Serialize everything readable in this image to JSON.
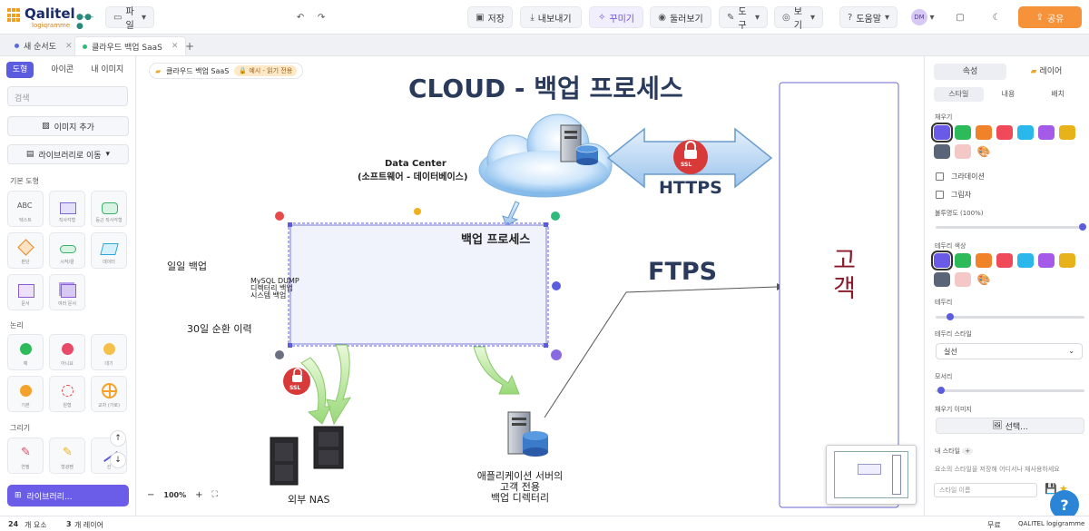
{
  "app": {
    "logo_name": "Qalitel",
    "logo_tagline": "logiqramme"
  },
  "toolbar": {
    "file_label": "파일",
    "undo_icon": "undo-icon",
    "redo_icon": "redo-icon",
    "save_label": "저장",
    "export_label": "내보내기",
    "beautify_label": "꾸미기",
    "tour_label": "둘러보기",
    "tools_label": "도구",
    "view_label": "보기",
    "help_label": "도움말",
    "avatar_initials": "DM",
    "share_label": "공유"
  },
  "tabs": [
    {
      "label": "새 순서도"
    },
    {
      "label": "클라우드 백업 SaaS"
    }
  ],
  "left_panel": {
    "tabs": [
      "도형",
      "아이콘",
      "내 이미지"
    ],
    "search_placeholder": "검색",
    "add_image_label": "이미지 추가",
    "library_label": "라이브러리로 이동",
    "section_basic": "기본 도형",
    "section_logic": "논리",
    "section_draw": "그리기",
    "basic_shapes": [
      "텍스트",
      "직사각형",
      "둥근 직사각형",
      "판단",
      "시작/끝",
      "데이터",
      "문서",
      "여러 문서"
    ],
    "logic_shapes": [
      "예",
      "아니요",
      "대기",
      "기본",
      "원형",
      "교차 (가로)"
    ],
    "draw_tools": [
      "연필",
      "형광펜",
      "선"
    ],
    "library_bottom_label": "라이브러리..."
  },
  "statusbar": {
    "elements_count": "24",
    "elements_label": "개 요소",
    "layers_count": "3",
    "layers_label": "개 레이어",
    "plan": "무료",
    "brand": "QALITEL logigramme"
  },
  "canvas": {
    "breadcrumb": "클라우드 백업 SaaS",
    "breadcrumb_badge": "예시 - 읽기 전용",
    "title": "CLOUD - 백업 프로세스",
    "datacenter_line1": "Data Center",
    "datacenter_line2": "(소프트웨어 - 데이터베이스)",
    "https_label": "HTTPS",
    "ftps_label": "FTPS",
    "process_label": "백업 프로세스",
    "mysql_line1": "MySQL DUMP",
    "mysql_line2": "디렉터리 백업",
    "mysql_line3": "시스템 백업",
    "daily_backup": "일일 백업",
    "rotation": "30일 순환 이력",
    "customer_label": "고객",
    "nas_label": "외부 NAS",
    "appserver_line1": "애플리케이션 서버의",
    "appserver_line2": "고객 전용",
    "appserver_line3": "백업 디렉터리",
    "ssl_label": "SSL",
    "zoom_level": "100%"
  },
  "right_panel": {
    "tab_properties": "속성",
    "tab_layers": "레이어",
    "sub_tabs": [
      "스타일",
      "내용",
      "배치"
    ],
    "fill_label": "채우기",
    "gradient_label": "그라데이션",
    "shadow_label": "그림자",
    "opacity_label": "불투명도 (100%)",
    "border_color_label": "테두리 색상",
    "border_label": "테두리",
    "border_style_label": "테두리 스타일",
    "border_style_value": "실선",
    "radius_label": "모서리",
    "fill_image_label": "채우기 이미지",
    "select_button": "선택...",
    "my_styles_label": "내 스타일",
    "my_styles_hint": "요소의 스타일을 저장해 어디서나 재사용하세요",
    "style_name_placeholder": "스타일 이름",
    "colors": [
      "#6a5ae8",
      "#2dbb5a",
      "#f0822a",
      "#f04a5a",
      "#2ab8ec",
      "#a55ae8",
      "#e8b21a",
      "#5a6478",
      "#f5c8c8"
    ]
  }
}
